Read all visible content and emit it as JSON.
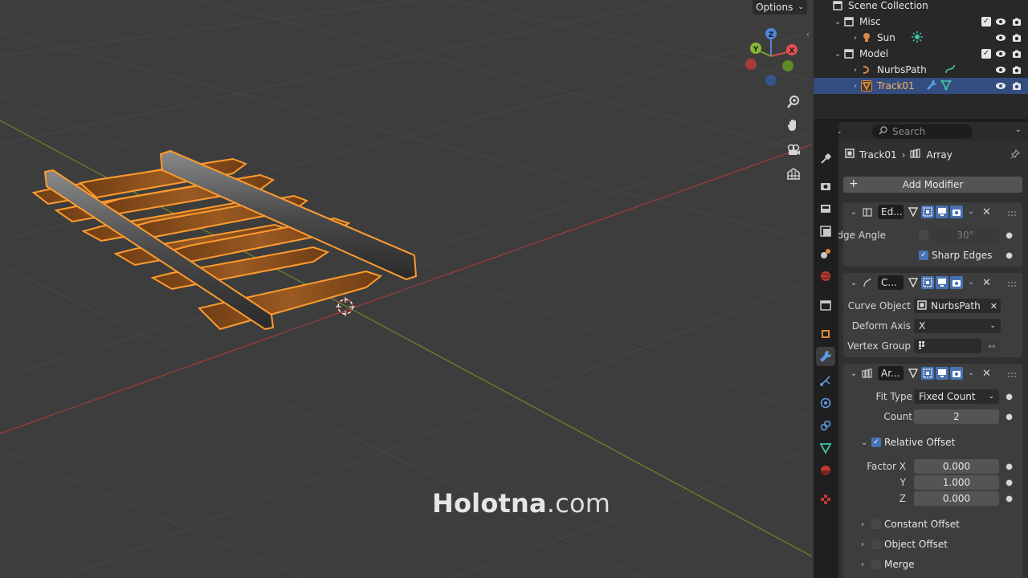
{
  "viewport": {
    "options_label": "Options",
    "gizmo": {
      "z": "Z",
      "y": "Y",
      "x": "X"
    },
    "watermark_bold": "Holotna",
    "watermark_rest": ".com",
    "nav_tools": [
      "zoom-icon",
      "hand-icon",
      "camera-icon",
      "grid-icon"
    ]
  },
  "outliner": {
    "rows": [
      {
        "name": "Scene Collection",
        "icon": "scene-collection-icon"
      },
      {
        "name": "Misc",
        "icon": "collection-icon"
      },
      {
        "name": "Sun",
        "icon": "light-icon"
      },
      {
        "name": "Model",
        "icon": "collection-icon"
      },
      {
        "name": "NurbsPath",
        "icon": "curve-icon"
      },
      {
        "name": "Track01",
        "icon": "mesh-icon",
        "selected": true
      }
    ]
  },
  "properties": {
    "search_placeholder": "Search",
    "breadcrumb": {
      "object": "Track01",
      "modifier": "Array"
    },
    "add_modifier_label": "Add Modifier",
    "modifiers": {
      "edge_split": {
        "name": "Ed...",
        "edge_angle_label": "Edge Angle",
        "edge_angle_value": "30°",
        "edge_angle_enabled": false,
        "sharp_edges_label": "Sharp Edges",
        "sharp_edges_enabled": true
      },
      "curve": {
        "name": "C...",
        "curve_object_label": "Curve Object",
        "curve_object_value": "NurbsPath",
        "deform_axis_label": "Deform Axis",
        "deform_axis_value": "X",
        "vertex_group_label": "Vertex Group",
        "vertex_group_value": ""
      },
      "array": {
        "name": "Ar...",
        "fit_type_label": "Fit Type",
        "fit_type_value": "Fixed Count",
        "count_label": "Count",
        "count_value": "2",
        "relative_offset_label": "Relative Offset",
        "relative_offset_enabled": true,
        "factor_x_label": "Factor X",
        "factor_x_value": "0.000",
        "factor_y_label": "Y",
        "factor_y_value": "1.000",
        "factor_z_label": "Z",
        "factor_z_value": "0.000",
        "constant_offset_label": "Constant Offset",
        "object_offset_label": "Object Offset",
        "merge_label": "Merge"
      }
    }
  },
  "colors": {
    "selection": "#334d80",
    "accent": "#4772b3",
    "outline_orange": "#ff9b2e",
    "wood": "#8a4f1c"
  }
}
